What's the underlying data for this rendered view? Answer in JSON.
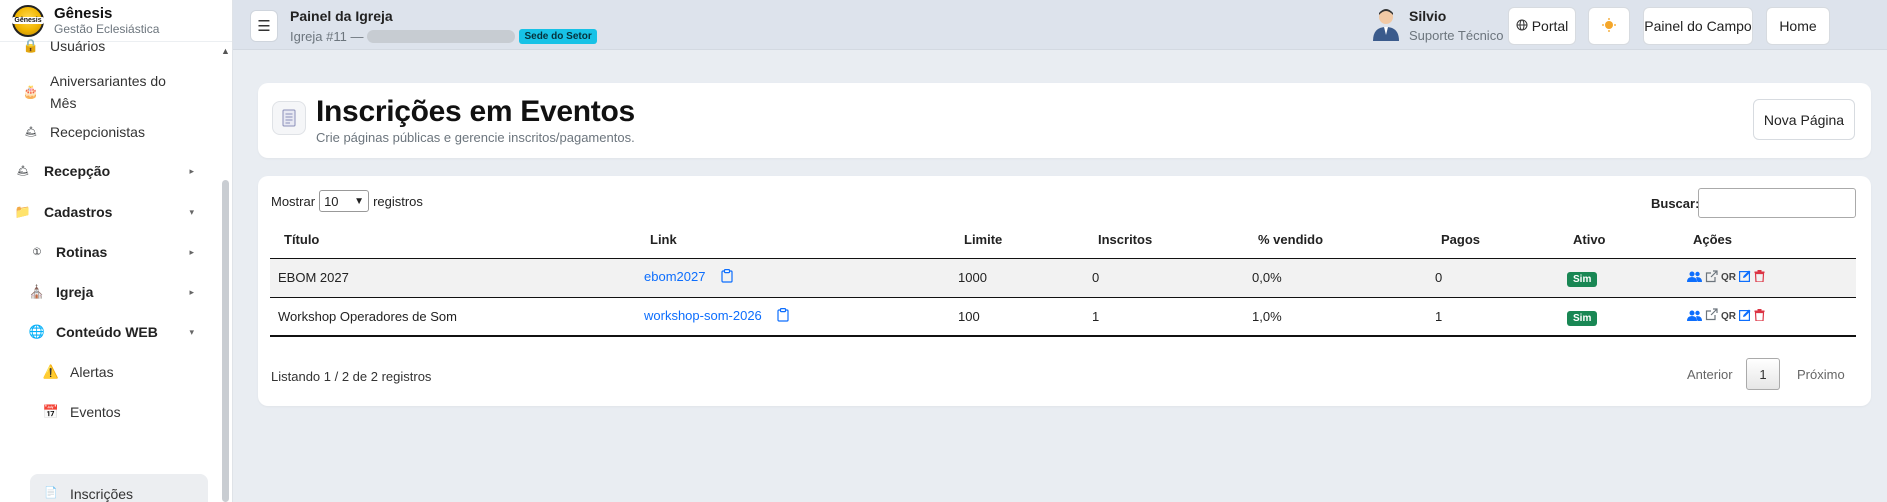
{
  "brand": {
    "name": "Gênesis",
    "subtitle": "Gestão Eclesiástica",
    "logo_text": "Gênesis"
  },
  "sidebar": {
    "items": [
      {
        "label": "Usuários",
        "icon": "lock-icon"
      },
      {
        "label": "Aniversariantes do",
        "label2": "Mês",
        "icon": "cake-icon"
      },
      {
        "label": "Recepcionistas",
        "icon": "bell-icon"
      },
      {
        "label": "Recepção",
        "icon": "bell-icon"
      },
      {
        "label": "Cadastros",
        "icon": "folder-icon"
      },
      {
        "label": "Rotinas",
        "icon": "number-one-icon"
      },
      {
        "label": "Igreja",
        "icon": "church-icon"
      },
      {
        "label": "Conteúdo WEB",
        "icon": "globe-icon"
      },
      {
        "label": "Alertas",
        "icon": "warning-icon"
      },
      {
        "label": "Eventos",
        "icon": "calendar-icon"
      },
      {
        "label": "Inscrições",
        "icon": "document-icon"
      }
    ]
  },
  "topbar": {
    "title": "Painel da Igreja",
    "subtitle_prefix": "Igreja #11 —",
    "badge": "Sede do Setor",
    "user_name": "Silvio",
    "user_role": "Suporte Técnico",
    "portal_label": "Portal",
    "painel_campo_label": "Painel do Campo",
    "home_label": "Home"
  },
  "page": {
    "title": "Inscrições em Eventos",
    "subtitle": "Crie páginas públicas e gerencie inscritos/pagamentos.",
    "new_page_label": "Nova Página"
  },
  "table": {
    "show_label": "Mostrar",
    "show_value": "10",
    "records_label": "registros",
    "search_label": "Buscar:",
    "headers": [
      "Título",
      "Link",
      "Limite",
      "Inscritos",
      "% vendido",
      "Pagos",
      "Ativo",
      "Ações"
    ],
    "rows": [
      {
        "titulo": "EBOM 2027",
        "link": "ebom2027",
        "limite": "1000",
        "inscritos": "0",
        "vendido": "0,0%",
        "pagos": "0",
        "ativo": "Sim"
      },
      {
        "titulo": "Workshop Operadores de Som",
        "link": "workshop-som-2026",
        "limite": "100",
        "inscritos": "1",
        "vendido": "1,0%",
        "pagos": "1",
        "ativo": "Sim"
      }
    ],
    "qr_label": "QR",
    "info": "Listando 1 / 2 de 2 registros",
    "prev": "Anterior",
    "page": "1",
    "next": "Próximo"
  },
  "colors": {
    "accent": "#0d6efd",
    "success": "#198754",
    "badge": "#17c2e6",
    "danger": "#dc3545"
  }
}
